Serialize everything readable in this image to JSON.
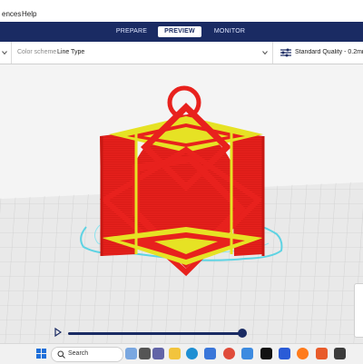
{
  "menu": {
    "left_fragment": "ences",
    "help": "Help"
  },
  "stages": {
    "prepare": "PREPARE",
    "preview": "PREVIEW",
    "monitor": "MONITOR"
  },
  "toolbar": {
    "color_scheme_label": "Color scheme",
    "color_scheme_value": "Line Type",
    "quality": "Standard Quality - 0.2mm"
  },
  "taskbar": {
    "search_placeholder": "Search"
  },
  "colors": {
    "header": "#1a2b63",
    "wall_outer": "#e8211d",
    "infill": "#e6e224",
    "skirt": "#5ed3e3",
    "plate": "#e8e8e8"
  },
  "preview": {
    "layer_slider_fraction": 0.98
  },
  "icons": [
    "play-icon",
    "windows-icon",
    "search-icon",
    "chevron-down-icon",
    "settings-sliders-icon"
  ]
}
